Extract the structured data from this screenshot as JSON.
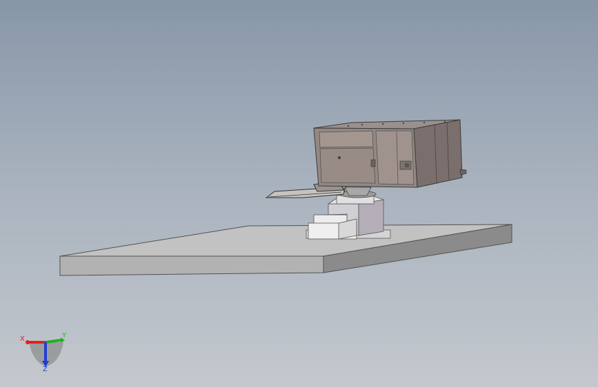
{
  "viewport": {
    "background_top": "#8796a8",
    "background_bottom": "#c4c8ce"
  },
  "triad": {
    "x_label": "X",
    "y_label": "Y",
    "z_label": "Z",
    "x_color": "#e02020",
    "y_color": "#22b022",
    "z_color": "#1f3fd0"
  }
}
